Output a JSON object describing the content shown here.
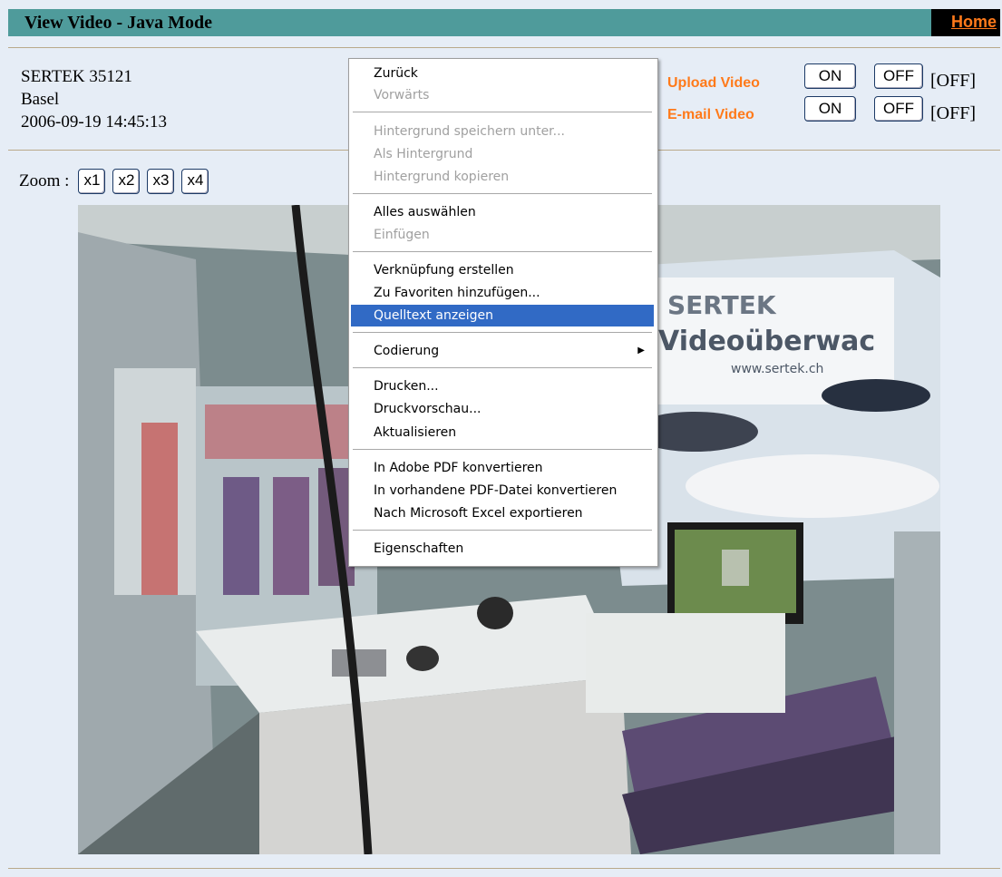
{
  "header": {
    "title": "View Video - Java Mode",
    "home_link": "Home"
  },
  "camera": {
    "name": "SERTEK 35121",
    "location": "Basel",
    "timestamp": "2006-09-19 14:45:13"
  },
  "zoom": {
    "label": "Zoom :",
    "buttons": [
      "x1",
      "x2",
      "x3",
      "x4"
    ]
  },
  "controls": {
    "upload": {
      "label": "Upload Video",
      "on": "ON",
      "off": "OFF",
      "state": "[OFF]"
    },
    "email": {
      "label": "E-mail Video",
      "on": "ON",
      "off": "OFF",
      "state": "[OFF]"
    }
  },
  "context_menu": {
    "items": [
      {
        "label": "Zurück",
        "enabled": true
      },
      {
        "label": "Vorwärts",
        "enabled": false
      },
      {
        "label": "Hintergrund speichern unter...",
        "enabled": false
      },
      {
        "label": "Als Hintergrund",
        "enabled": false
      },
      {
        "label": "Hintergrund kopieren",
        "enabled": false
      },
      {
        "label": "Alles auswählen",
        "enabled": true
      },
      {
        "label": "Einfügen",
        "enabled": false
      },
      {
        "label": "Verknüpfung erstellen",
        "enabled": true
      },
      {
        "label": "Zu Favoriten hinzufügen...",
        "enabled": true
      },
      {
        "label": "Quelltext anzeigen",
        "enabled": true,
        "selected": true
      },
      {
        "label": "Codierung",
        "enabled": true,
        "submenu": true
      },
      {
        "label": "Drucken...",
        "enabled": true
      },
      {
        "label": "Druckvorschau...",
        "enabled": true
      },
      {
        "label": "Aktualisieren",
        "enabled": true
      },
      {
        "label": "In Adobe PDF konvertieren",
        "enabled": true
      },
      {
        "label": "In vorhandene PDF-Datei konvertieren",
        "enabled": true
      },
      {
        "label": "Nach Microsoft Excel exportieren",
        "enabled": true
      },
      {
        "label": "Eigenschaften",
        "enabled": true
      }
    ]
  },
  "video_feed": {
    "sign_text_1": "SERTEK",
    "sign_text_2": "Videoüberwac",
    "sign_text_3": "www.sertek.ch"
  },
  "colors": {
    "title_bar": "#4f9b9b",
    "accent": "#ff7a1a",
    "menu_highlight": "#316ac5"
  }
}
